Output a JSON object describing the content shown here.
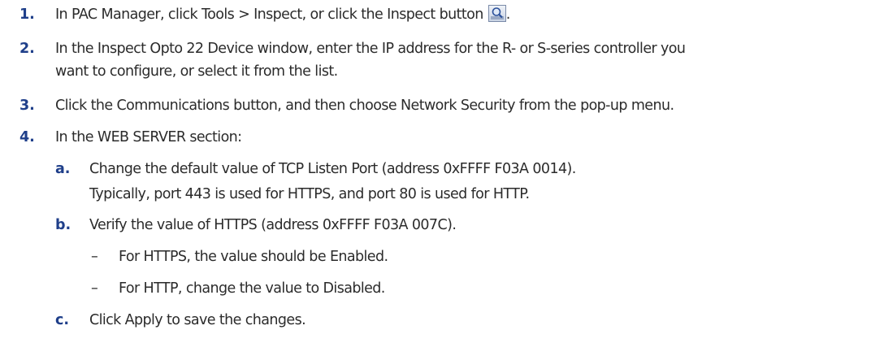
{
  "steps": [
    {
      "num": "1.",
      "text": "In PAC Manager, click Tools > Inspect, or click the Inspect button",
      "suffix": "."
    },
    {
      "num": "2.",
      "line1": "In the Inspect Opto 22 Device window, enter the IP address for the R- or S-series controller you",
      "line2": "want to configure, or select it from the list."
    },
    {
      "num": "3.",
      "text": "Click the Communications button, and then choose Network Security from the pop-up menu."
    },
    {
      "num": "4.",
      "text": "In the WEB SERVER section:"
    }
  ],
  "substeps": [
    {
      "letter": "a.",
      "line1": "Change the default value of TCP Listen Port (address 0xFFFF F03A 0014).",
      "line2": "Typically, port 443 is used for HTTPS, and port 80 is used for HTTP."
    },
    {
      "letter": "b.",
      "text": "Verify the value of HTTPS (address 0xFFFF F03A 007C).",
      "bullets": [
        "For HTTPS, the value should be Enabled.",
        "For HTTP, change the value to Disabled."
      ]
    },
    {
      "letter": "c.",
      "text": "Click Apply to save the changes."
    }
  ],
  "dash_glyph": "–",
  "icons": {
    "inspect_button": "magnifier-inspect-icon"
  },
  "colors": {
    "number": "#1f3f8a",
    "text": "#2b2b2b"
  }
}
